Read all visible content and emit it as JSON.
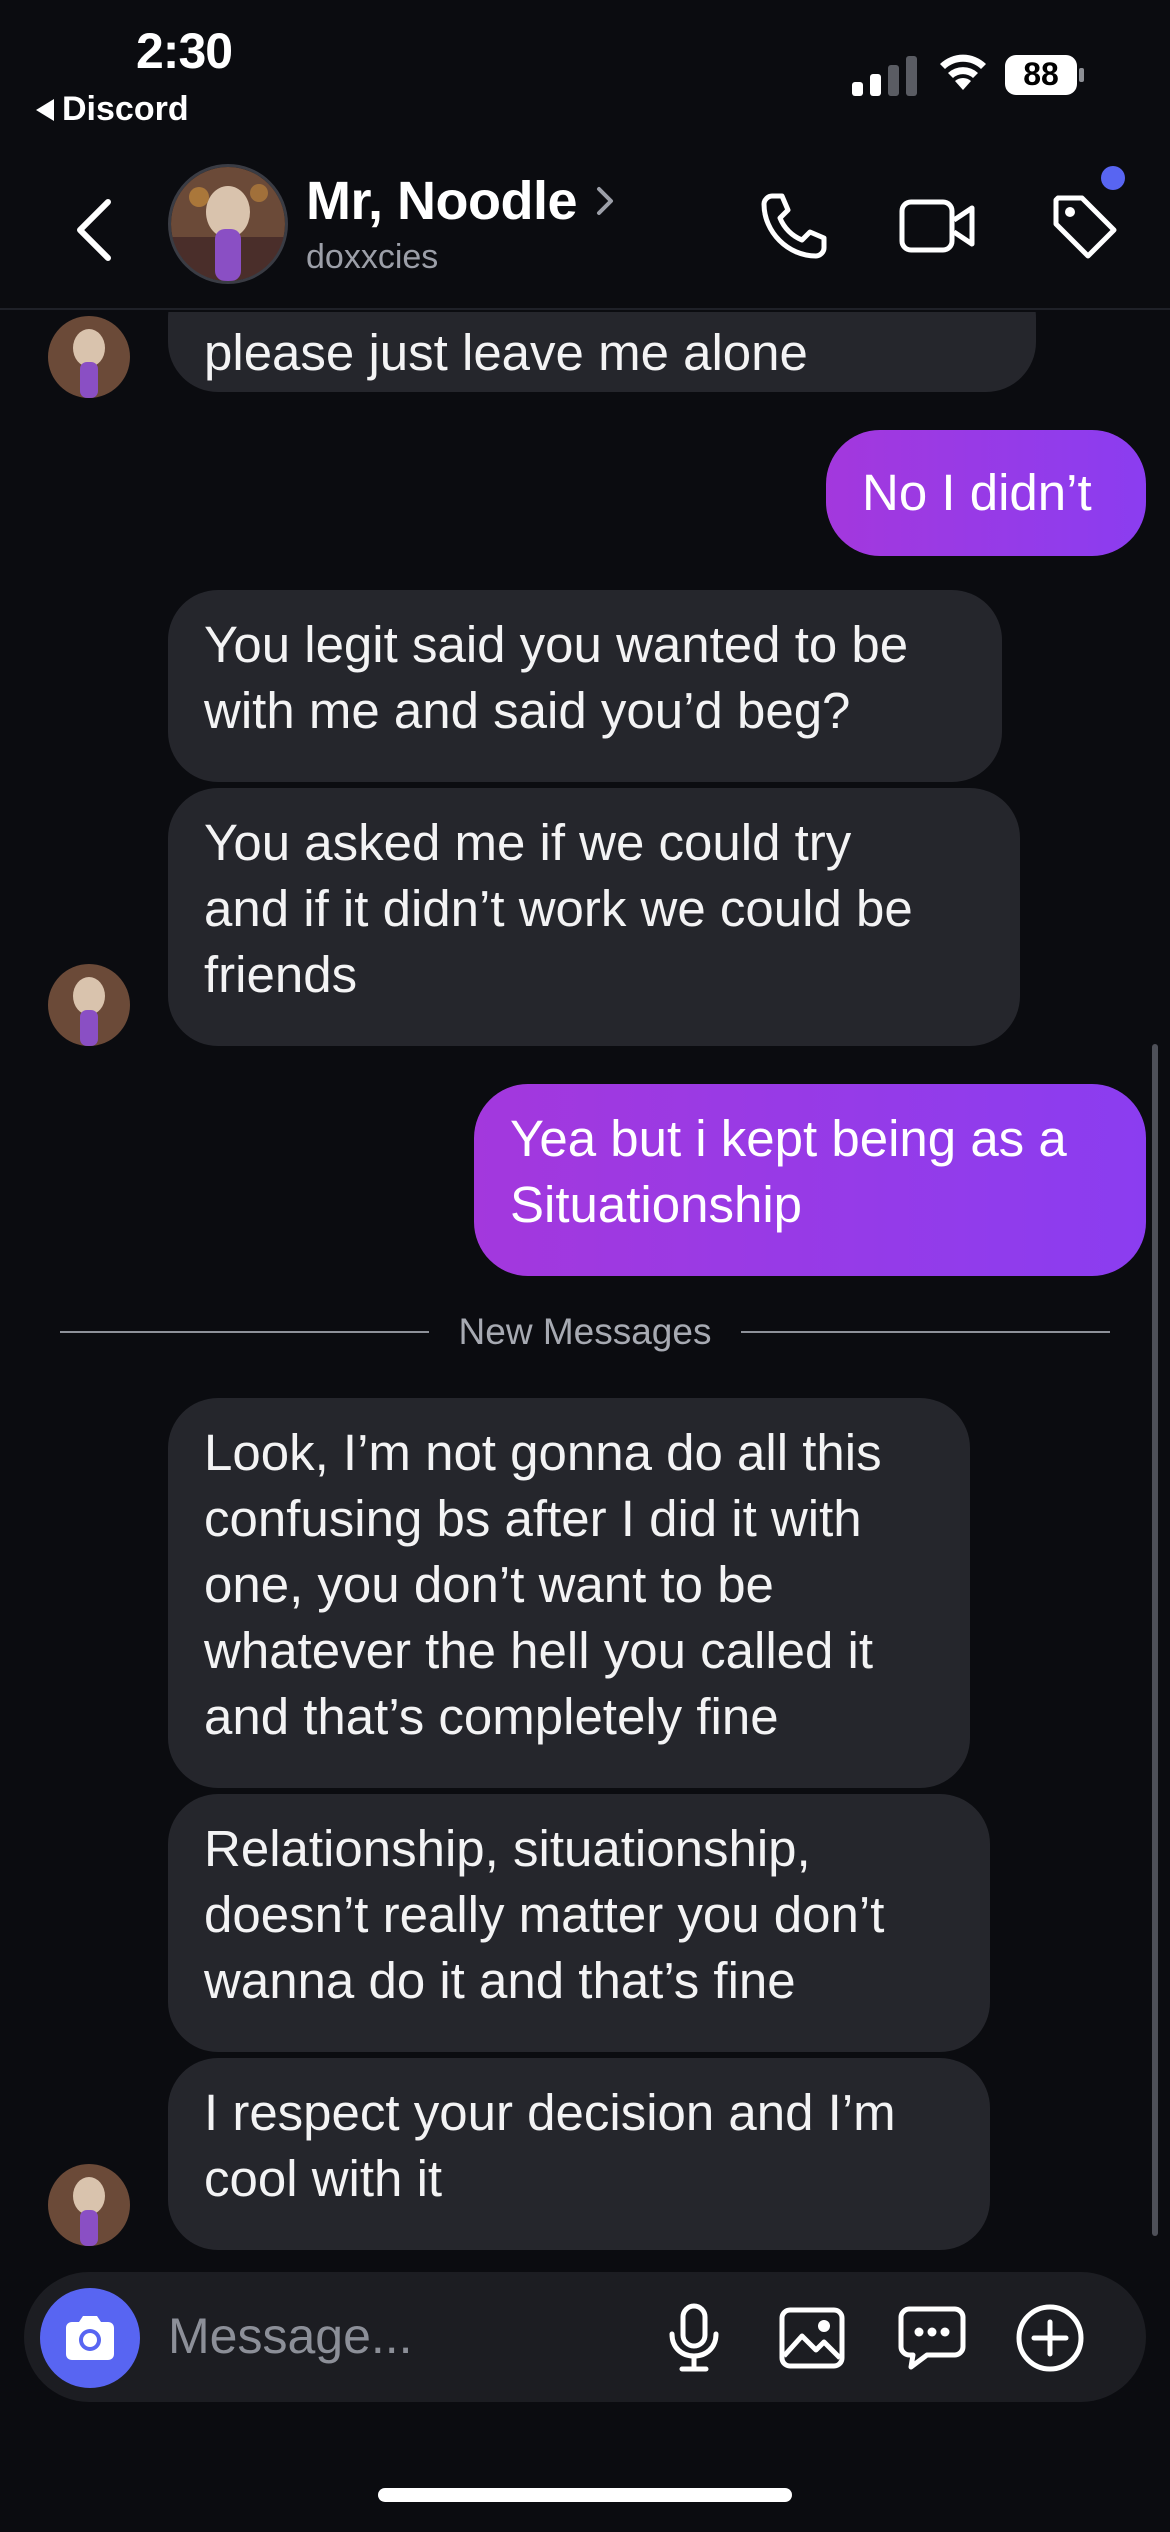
{
  "status_bar": {
    "time": "2:30",
    "back_app": "Discord",
    "battery": "88"
  },
  "header": {
    "contact_name": "Mr, Noodle",
    "contact_handle": "doxxcies",
    "icons": [
      "back-chevron-icon",
      "phone-icon",
      "video-camera-icon",
      "tag-icon"
    ],
    "notification_dot_color": "#5865f2"
  },
  "messages": [
    {
      "side": "received",
      "text": "please just leave me alone"
    },
    {
      "side": "sent",
      "text": "No I didn’t"
    },
    {
      "side": "received",
      "text": "You legit said you wanted to be\nwith me and said you’d beg?"
    },
    {
      "side": "received",
      "text": "You asked me if we could try\nand if it didn’t work we could be\nfriends"
    },
    {
      "side": "sent",
      "text": "Yea but i kept being as a\nSituationship"
    },
    {
      "side": "received",
      "text": "Look, I’m not gonna do all this\nconfusing bs after I did it with\none, you don’t want to be\nwhatever the hell you called it\nand that’s completely fine"
    },
    {
      "side": "received",
      "text": "Relationship, situationship,\ndoesn’t really matter you don’t\nwanna do it and that’s fine"
    },
    {
      "side": "received",
      "text": "I respect your decision and I’m\ncool with it"
    }
  ],
  "divider": {
    "label": "New Messages"
  },
  "composer": {
    "placeholder": "Message...",
    "icons": [
      "camera-icon",
      "microphone-icon",
      "image-icon",
      "chat-bubble-icon",
      "plus-circle-icon"
    ]
  },
  "colors": {
    "background": "#0b0c10",
    "received_bubble": "#25262c",
    "sent_bubble": "#9b3be6",
    "accent": "#5865f2"
  }
}
